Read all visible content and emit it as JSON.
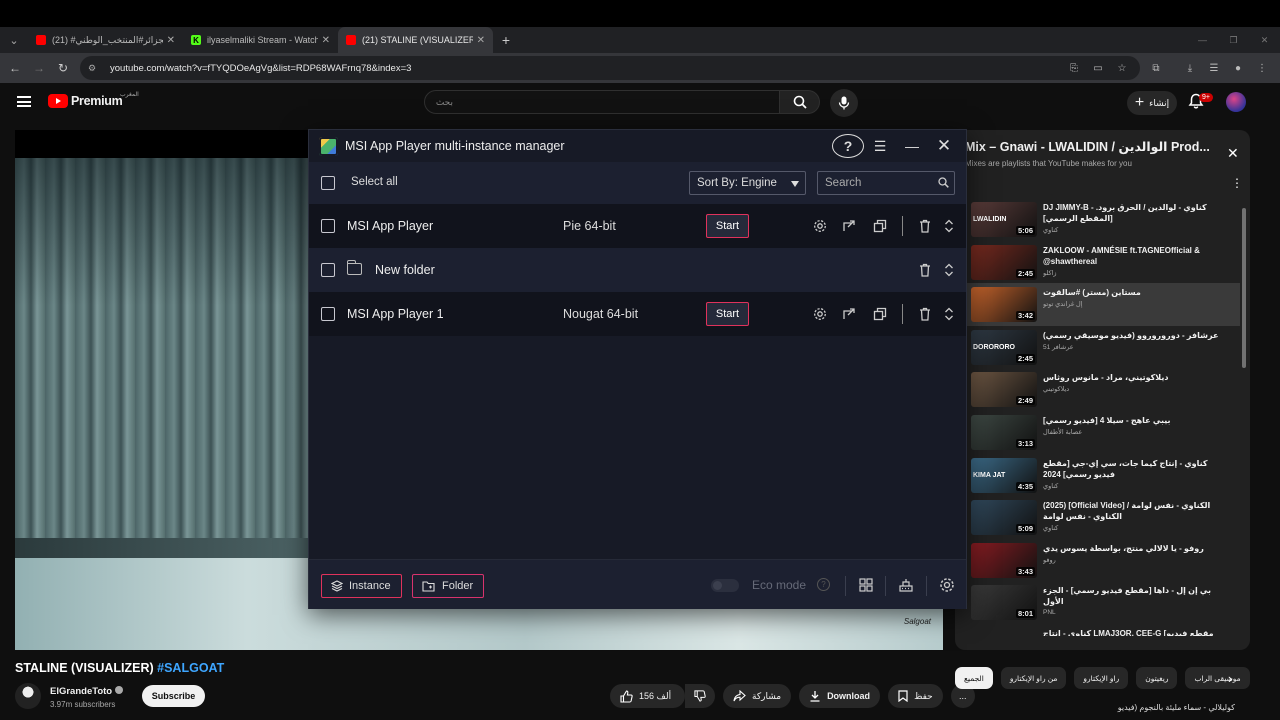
{
  "browser": {
    "tabs": [
      {
        "title": "(21) #الجزائر#المنتخب_الوطني #",
        "icon": "youtube-icon"
      },
      {
        "title": "ilyaselmaliki Stream - Watch Live",
        "icon": "kick-icon",
        "fav": "K"
      },
      {
        "title": "(21) STALINE (VISUALIZER) #",
        "icon": "youtube-icon"
      }
    ],
    "url": "youtube.com/watch?v=fTYQDOeAgVg&list=RDP68WAFrnq78&index=3"
  },
  "youtube": {
    "logo_text": "Premium",
    "country_code": "المغرب",
    "search_placeholder": "بحث",
    "create_label": "إنشاء",
    "notification_count": "9+",
    "video_title": "STALINE (VISUALIZER)",
    "video_tag": "#SALGOAT",
    "watermark": "Salgoat",
    "channel_name": "ElGrandeToto",
    "subscribers": "3.97m subscribers",
    "subscribe_label": "Subscribe",
    "likes": "156 ألف",
    "share_label": "مشاركة",
    "download_label": "Download",
    "save_label": "حفظ",
    "more_label": "..."
  },
  "mix": {
    "title": "Mix – Gnawi - LWALIDIN / الوالدين Prod...",
    "subtitle": "Mixes are playlists that YouTube makes for you",
    "items": [
      {
        "title": "DJ JIMMY-B - كناوي - لوالدين / الحرق برود. [المقطع الرسمي]",
        "channel": "كناوي",
        "duration": "5:06",
        "thumb_text": "LWALIDIN",
        "active": false
      },
      {
        "title": "ZAKLOOW - AMNÉSIE ft.TAGNEOfficial & @shawthereal",
        "channel": "زاكلو",
        "duration": "2:45",
        "thumb_text": "",
        "active": false
      },
      {
        "title": "مستاين (مستر) #سالقوت",
        "channel": "إل غراندي توتو",
        "duration": "3:42",
        "thumb_text": "",
        "active": true
      },
      {
        "title": "عرشافر - دوروروروو (فيديو موسيقي رسمي)",
        "channel": "51 عرشافر",
        "duration": "2:45",
        "thumb_text": "DORORORO",
        "active": false
      },
      {
        "title": "ديلاكوتيني، مراد - مانوس روثاس",
        "channel": "ديلاكوتيني",
        "duration": "2:49",
        "thumb_text": "",
        "active": false
      },
      {
        "title": "بيبي عاهج - سيلا 4 [فيديو رسمي]",
        "channel": "عصابة الأطفال",
        "duration": "3:13",
        "thumb_text": "",
        "active": false
      },
      {
        "title": "كناوي - إنتاج كيما جات، سي إي-جي [مقطع فيديو رسمي] 2024",
        "channel": "كناوي",
        "duration": "4:35",
        "thumb_text": "KIMA JAT",
        "active": false
      },
      {
        "title": "(2025) [Official Video] الكناوي - نفس لوامة / الكناوي - نفس لوامة",
        "channel": "كناوي",
        "duration": "5:09",
        "thumb_text": "",
        "active": false
      },
      {
        "title": "روفو - يا لالالي منتج، بواسطة يسوس يدي",
        "channel": "روفو",
        "duration": "3:43",
        "thumb_text": "",
        "active": false
      },
      {
        "title": "بي إن إل - داها [مقطع فيديو رسمي] - الجزء الأول",
        "channel": "PNL",
        "duration": "8:01",
        "thumb_text": "",
        "active": false
      }
    ],
    "peek": "كناوي - إنتاج LMAJ3OR, CEE-G [مقطع فيديو",
    "bottom_text": "كوليلالي - سماء مليئة بالنجوم (فيديو"
  },
  "chips": [
    "الجميع",
    "من راو الإيكتارو",
    "راو الإيكتارو",
    "ريغيتون",
    "موسيقى الراب"
  ],
  "msi": {
    "title": "MSI App Player multi-instance manager",
    "select_all": "Select all",
    "sort_label": "Sort By: Engine",
    "search_placeholder": "Search",
    "instances": [
      {
        "name": "MSI App Player",
        "engine": "Pie 64-bit",
        "start": "Start",
        "type": "instance"
      },
      {
        "name": "New folder",
        "engine": "",
        "start": "",
        "type": "folder"
      },
      {
        "name": "MSI App Player 1",
        "engine": "Nougat 64-bit",
        "start": "Start",
        "type": "instance"
      }
    ],
    "footer": {
      "instance_label": "Instance",
      "folder_label": "Folder",
      "eco_label": "Eco mode",
      "eco_on": false
    },
    "colors": {
      "accent": "#e0325c",
      "bg": "#171a26",
      "row_alt": "#1c2030"
    }
  }
}
